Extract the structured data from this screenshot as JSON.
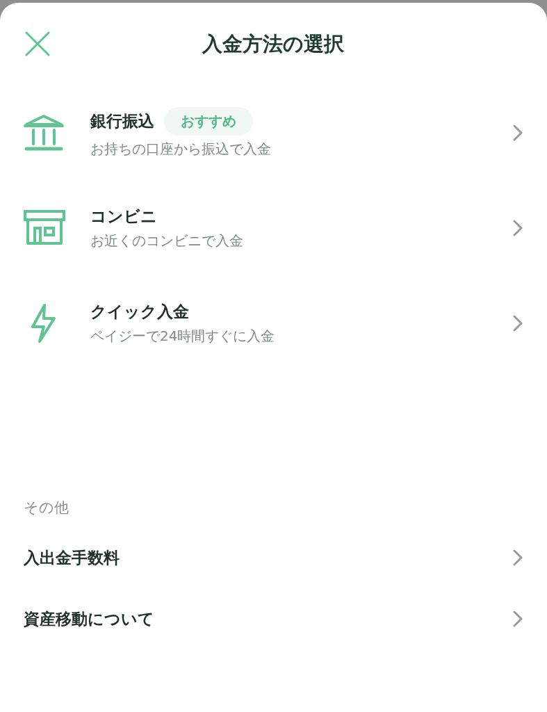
{
  "header": {
    "title": "入金方法の選択"
  },
  "methods": [
    {
      "title": "銀行振込",
      "badge": "おすすめ",
      "description": "お持ちの口座から振込で入金"
    },
    {
      "title": "コンビニ",
      "description": "お近くのコンビニで入金"
    },
    {
      "title": "クイック入金",
      "description": "ペイジーで24時間すぐに入金"
    }
  ],
  "other": {
    "heading": "その他",
    "links": [
      "入出金手数料",
      "資産移動について"
    ]
  }
}
